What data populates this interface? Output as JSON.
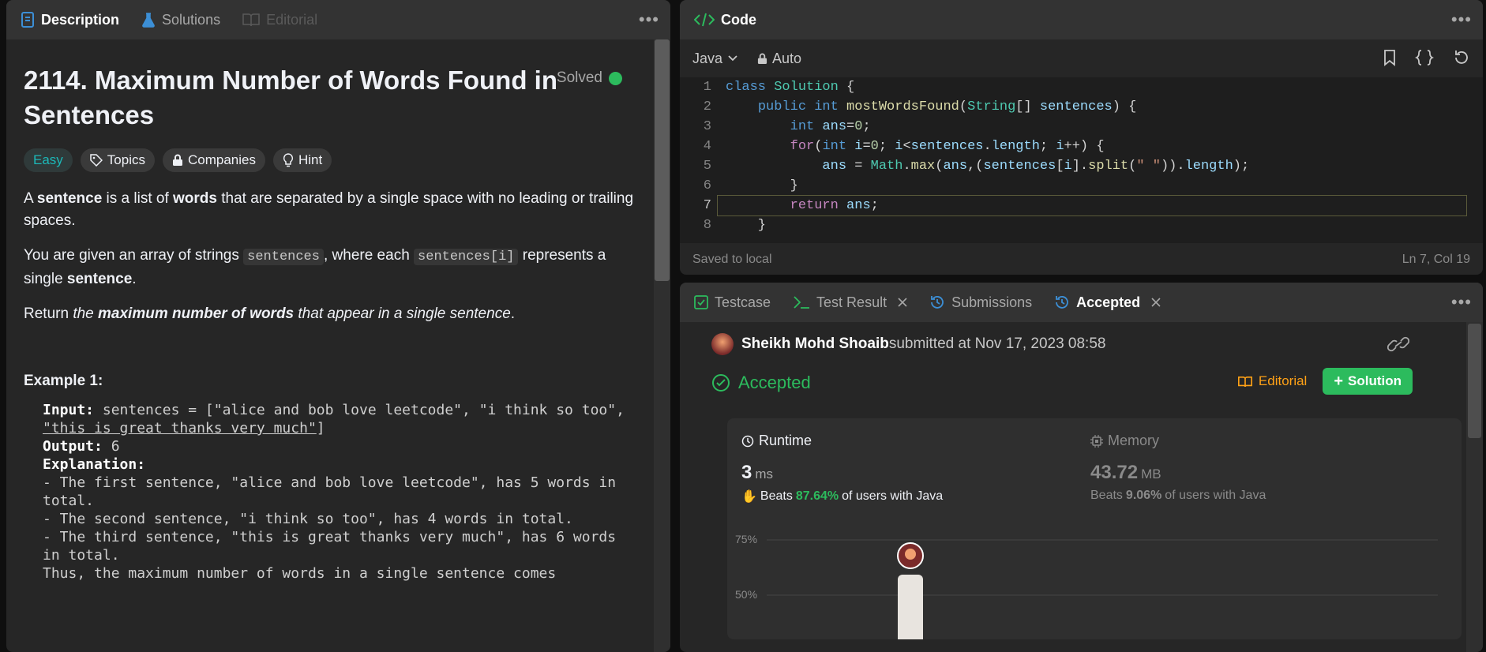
{
  "left_tabs": [
    "Description",
    "Solutions",
    "Editorial"
  ],
  "problem": {
    "title": "2114. Maximum Number of Words Found in Sentences",
    "status": "Solved",
    "difficulty": "Easy",
    "chips": [
      "Topics",
      "Companies",
      "Hint"
    ],
    "p1_a": "A ",
    "p1_b": "sentence",
    "p1_c": " is a list of ",
    "p1_d": "words",
    "p1_e": " that are separated by a single space with no leading or trailing spaces.",
    "p2_a": "You are given an array of strings ",
    "p2_code1": "sentences",
    "p2_b": ", where each ",
    "p2_code2": "sentences[i]",
    "p2_c": " represents a single ",
    "p2_d": "sentence",
    "p2_e": ".",
    "p3_a": "Return ",
    "p3_b": "the ",
    "p3_c": "maximum number of words",
    "p3_d": " that appear in a single sentence",
    "p3_e": ".",
    "example_title": "Example 1:",
    "input_label": "Input:",
    "input_value_a": " sentences = [\"alice and bob love leetcode\", \"i think so too\", ",
    "input_value_b": "\"this is great thanks very much\"",
    "input_value_c": "]",
    "output_label": "Output:",
    "output_value": " 6",
    "explanation_label": "Explanation:",
    "explanation_lines": [
      "- The first sentence, \"alice and bob love leetcode\", has 5 words in total.",
      "- The second sentence, \"i think so too\", has 4 words in total.",
      "- The third sentence, \"this is great thanks very much\", has 6 words in total.",
      "Thus, the maximum number of words in a single sentence comes"
    ]
  },
  "code_panel": {
    "title": "Code",
    "language": "Java",
    "mode": "Auto",
    "status_left": "Saved to local",
    "status_right": "Ln 7, Col 19",
    "line_numbers": [
      "1",
      "2",
      "3",
      "4",
      "5",
      "6",
      "7",
      "8"
    ]
  },
  "result_tabs": [
    "Testcase",
    "Test Result",
    "Submissions",
    "Accepted"
  ],
  "submission": {
    "user": "Sheikh Mohd Shoaib",
    "submitted_text": " submitted at Nov 17, 2023 08:58",
    "result": "Accepted",
    "editorial_label": "Editorial",
    "solution_label": "Solution",
    "runtime_label": "Runtime",
    "runtime_value": "3",
    "runtime_unit": "ms",
    "runtime_beats_prefix": "Beats ",
    "runtime_beats_pct": "87.64%",
    "runtime_beats_suffix": " of users with Java",
    "memory_label": "Memory",
    "memory_value": "43.72",
    "memory_unit": "MB",
    "memory_beats_prefix": "Beats ",
    "memory_beats_pct": "9.06%",
    "memory_beats_suffix": " of users with Java",
    "chart_tick_75": "75%",
    "chart_tick_50": "50%"
  },
  "colors": {
    "accent_green": "#2cbb5d",
    "accent_orange": "#ffa116",
    "easy_teal": "#1cb8b8"
  }
}
